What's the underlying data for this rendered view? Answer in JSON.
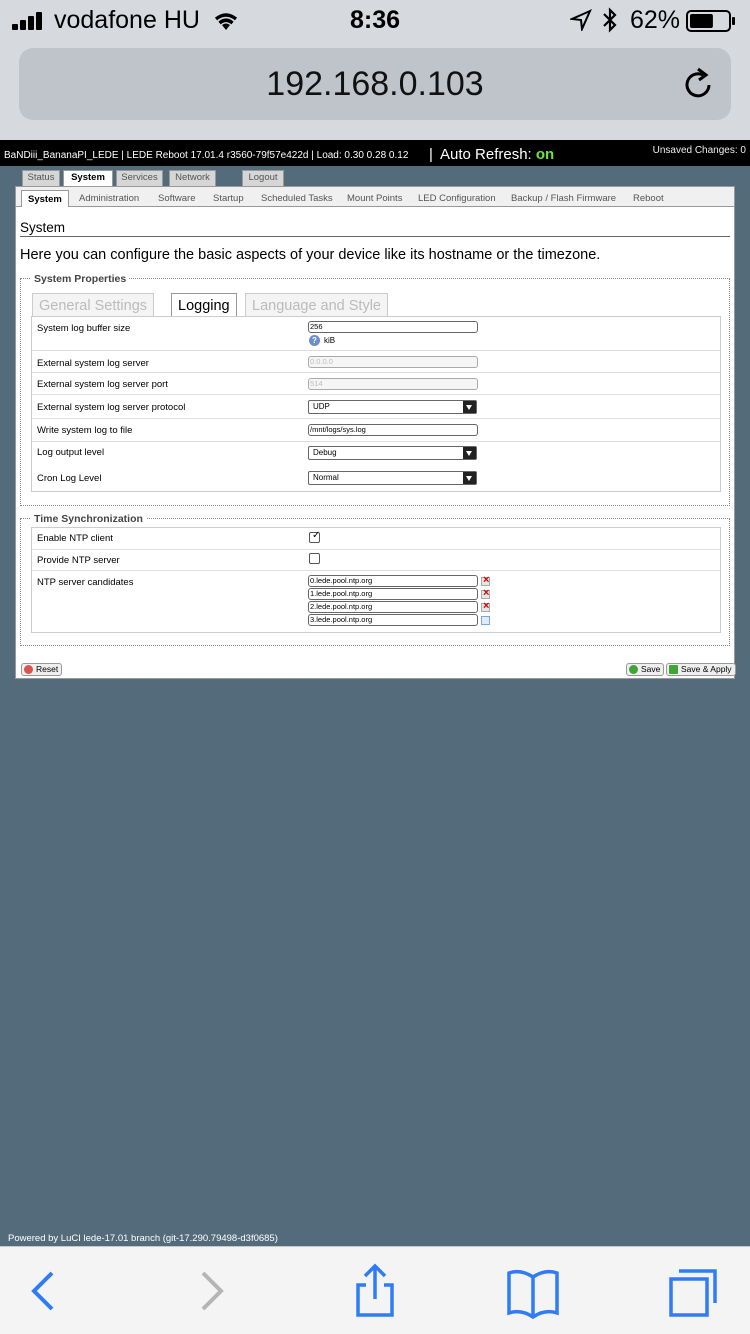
{
  "ios": {
    "carrier": "vodafone HU",
    "time": "8:36",
    "battery": "62%",
    "battery_level": 0.62,
    "url": "192.168.0.103"
  },
  "header": {
    "info": "BaNDiii_BananaPI_LEDE | LEDE Reboot 17.01.4 r3560-79f57e422d | Load: 0.30 0.28 0.12",
    "separator": "|",
    "auto_refresh_label": "Auto Refresh:",
    "auto_refresh_state": "on",
    "unsaved": "Unsaved Changes: 0"
  },
  "top_tabs": [
    "Status",
    "System",
    "Services",
    "Network",
    "Logout"
  ],
  "sub_tabs": [
    "System",
    "Administration",
    "Software",
    "Startup",
    "Scheduled Tasks",
    "Mount Points",
    "LED Configuration",
    "Backup / Flash Firmware",
    "Reboot"
  ],
  "page": {
    "title": "System",
    "description": "Here you can configure the basic aspects of your device like its hostname or the timezone."
  },
  "system_properties": {
    "legend": "System Properties",
    "tabs": [
      "General Settings",
      "Logging",
      "Language and Style"
    ],
    "fields": {
      "buffer_label": "System log buffer size",
      "buffer_value": "256",
      "buffer_help": "?",
      "buffer_unit": "kiB",
      "ext_server_label": "External system log server",
      "ext_server_placeholder": "0.0.0.0",
      "ext_port_label": "External system log server port",
      "ext_port_placeholder": "514",
      "protocol_label": "External system log server protocol",
      "protocol_value": "UDP",
      "write_file_label": "Write system log to file",
      "write_file_value": "/mnt/logs/sys.log",
      "output_level_label": "Log output level",
      "output_level_value": "Debug",
      "cron_level_label": "Cron Log Level",
      "cron_level_value": "Normal"
    }
  },
  "time_sync": {
    "legend": "Time Synchronization",
    "ntp_client_label": "Enable NTP client",
    "ntp_client_checked": "✓",
    "ntp_server_label": "Provide NTP server",
    "candidates_label": "NTP server candidates",
    "candidates": [
      "0.lede.pool.ntp.org",
      "1.lede.pool.ntp.org",
      "2.lede.pool.ntp.org",
      "3.lede.pool.ntp.org"
    ]
  },
  "buttons": {
    "reset": "Reset",
    "save": "Save",
    "save_apply": "Save & Apply"
  },
  "footer": "Powered by LuCI lede-17.01 branch (git-17.290.79498-d3f0685)",
  "colors": {
    "page_bg": "#546B7C",
    "auto_refresh_on": "#6FE33D"
  }
}
